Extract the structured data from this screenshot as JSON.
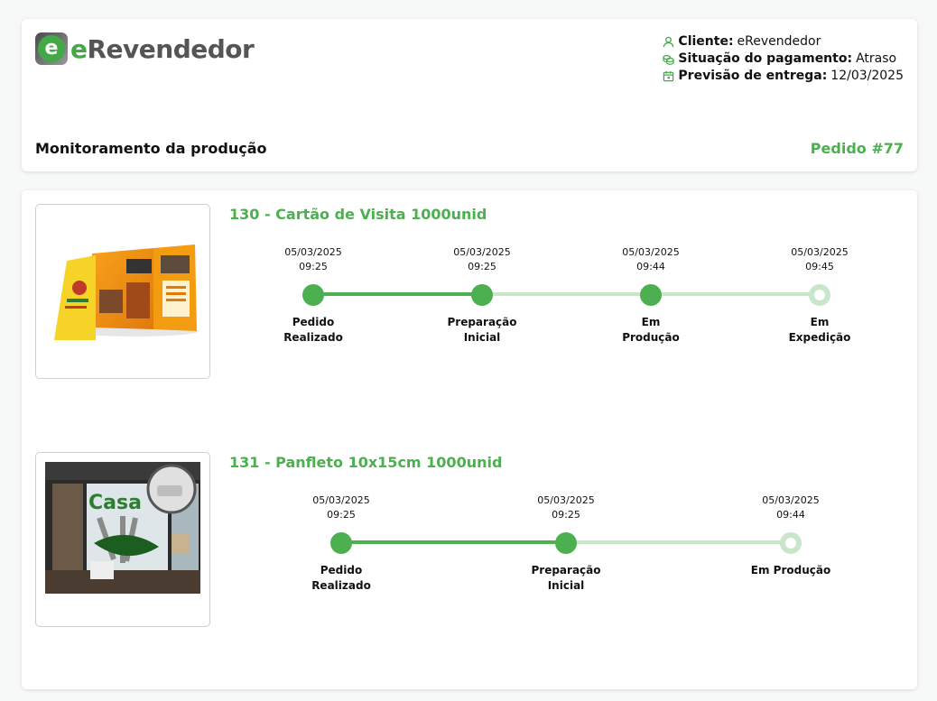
{
  "brand": {
    "name": "eRevendedor",
    "first_letter": "e",
    "rest": "Revendedor",
    "accent": "#43a947"
  },
  "info": {
    "client_label": "Cliente:",
    "client_value": "eRevendedor",
    "payment_label": "Situação do pagamento:",
    "payment_value": "Atraso",
    "delivery_label": "Previsão de entrega:",
    "delivery_value": "12/03/2025"
  },
  "section_title": "Monitoramento da produção",
  "order_number": "Pedido #77",
  "products": [
    {
      "title": "130 - Cartão de Visita 1000unid",
      "image_icon": "brochure-image",
      "steps": [
        {
          "date": "05/03/2025",
          "time": "09:25",
          "label_1": "Pedido",
          "label_2": "Realizado",
          "status": "done"
        },
        {
          "date": "05/03/2025",
          "time": "09:25",
          "label_1": "Preparação",
          "label_2": "Inicial",
          "status": "done"
        },
        {
          "date": "05/03/2025",
          "time": "09:44",
          "label_1": "Em",
          "label_2": "Produção",
          "status": "done"
        },
        {
          "date": "05/03/2025",
          "time": "09:45",
          "label_1": "Em",
          "label_2": "Expedição",
          "status": "current"
        }
      ]
    },
    {
      "title": "131 - Panfleto 10x15cm 1000unid",
      "image_icon": "storefront-image",
      "image_text": "Casa",
      "steps": [
        {
          "date": "05/03/2025",
          "time": "09:25",
          "label_1": "Pedido",
          "label_2": "Realizado",
          "status": "done"
        },
        {
          "date": "05/03/2025",
          "time": "09:25",
          "label_1": "Preparação",
          "label_2": "Inicial",
          "status": "done"
        },
        {
          "date": "05/03/2025",
          "time": "09:44",
          "label_1": "Em Produção",
          "label_2": "",
          "status": "current"
        }
      ]
    }
  ],
  "colors": {
    "done": "#4caf50",
    "todo": "#c8e6c9",
    "icon": "#43a947"
  }
}
